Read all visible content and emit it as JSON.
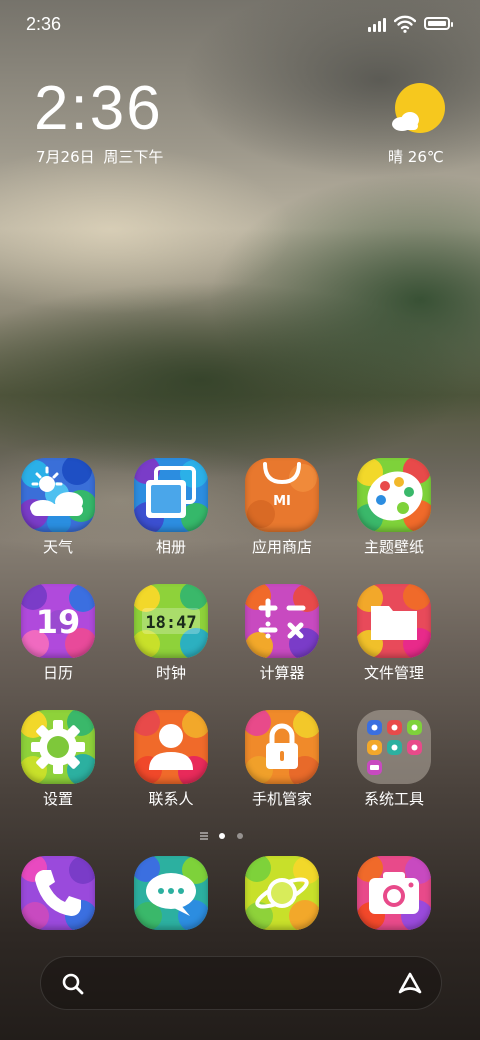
{
  "status_bar": {
    "time": "2:36",
    "icons": [
      "signal-icon",
      "wifi-icon",
      "battery-icon"
    ]
  },
  "clock_widget": {
    "time": "2:36",
    "date": "7月26日",
    "weekday": "周三下午"
  },
  "weather_widget": {
    "condition": "晴",
    "temperature": "26℃",
    "icon": "sun-cloud-icon"
  },
  "apps": [
    {
      "label": "天气",
      "icon": "weather-icon"
    },
    {
      "label": "相册",
      "icon": "gallery-icon"
    },
    {
      "label": "应用商店",
      "icon": "app-store-icon",
      "glyph": "MI"
    },
    {
      "label": "主题壁纸",
      "icon": "themes-palette-icon"
    },
    {
      "label": "日历",
      "icon": "calendar-icon",
      "glyph": "19"
    },
    {
      "label": "时钟",
      "icon": "clock-icon",
      "glyph": "18:47"
    },
    {
      "label": "计算器",
      "icon": "calculator-icon"
    },
    {
      "label": "文件管理",
      "icon": "file-manager-icon"
    },
    {
      "label": "设置",
      "icon": "settings-gear-icon"
    },
    {
      "label": "联系人",
      "icon": "contacts-icon"
    },
    {
      "label": "手机管家",
      "icon": "security-lock-icon"
    },
    {
      "label": "系统工具",
      "icon": "system-tools-folder-icon"
    }
  ],
  "page_indicator": {
    "pages": 2,
    "current": 1
  },
  "dock": [
    {
      "icon": "phone-icon"
    },
    {
      "icon": "messages-icon"
    },
    {
      "icon": "browser-planet-icon"
    },
    {
      "icon": "camera-icon"
    }
  ],
  "search_bar": {
    "value": "",
    "left_icon": "search-icon",
    "right_icon": "assistant-icon"
  },
  "colors": {
    "sun": "#f6c81e",
    "store_orange": "#e8782e"
  }
}
